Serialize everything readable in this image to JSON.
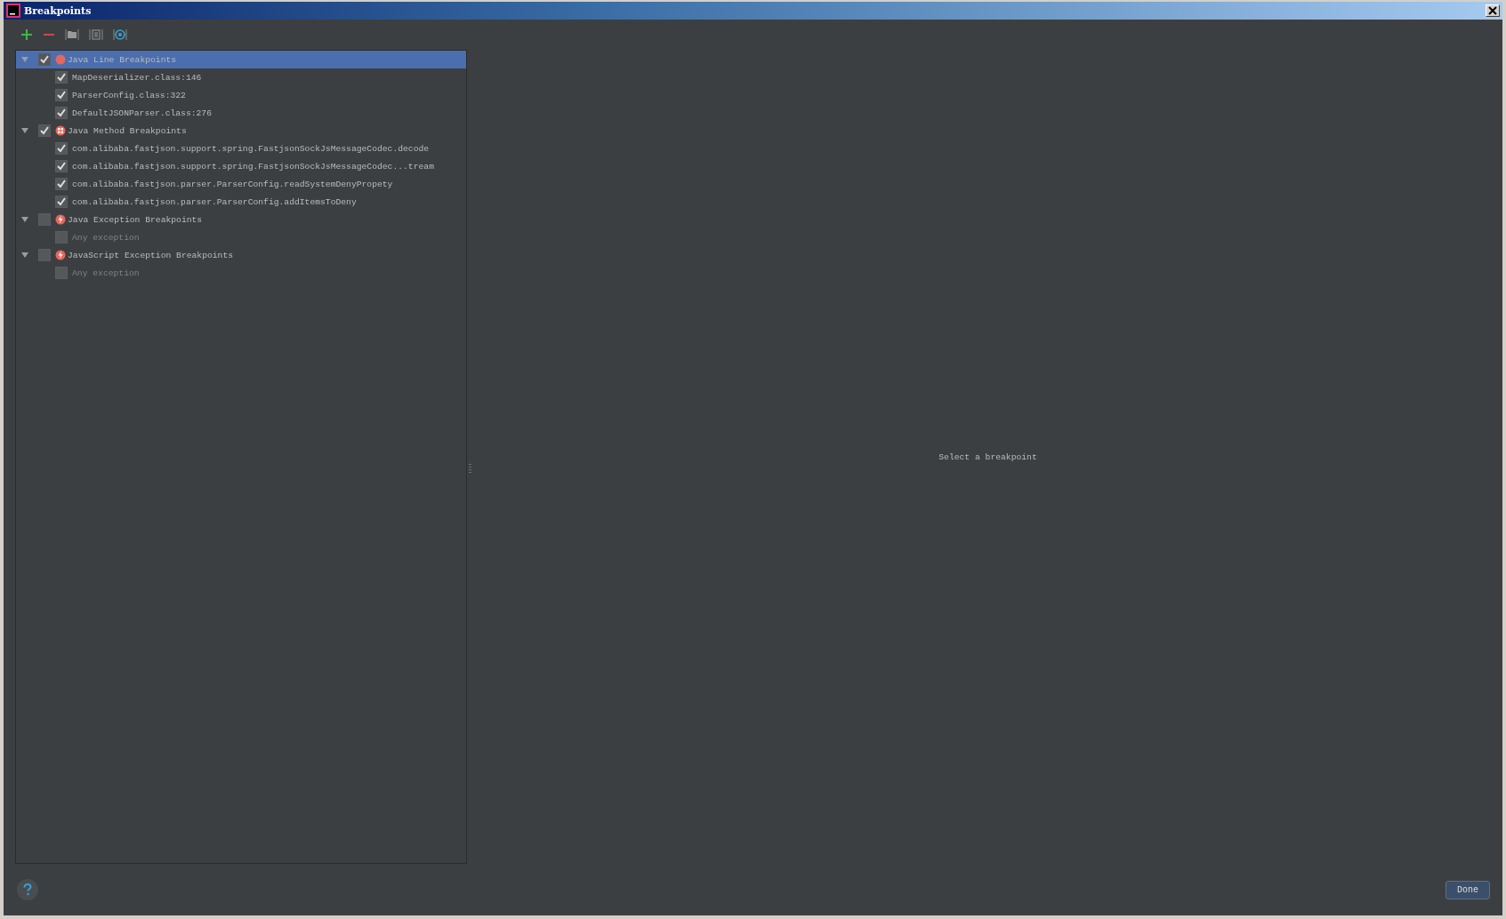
{
  "window": {
    "title": "Breakpoints"
  },
  "toolbar": [
    {
      "kind": "add"
    },
    {
      "kind": "remove"
    },
    {
      "kind": "folder"
    },
    {
      "kind": "document"
    },
    {
      "kind": "target"
    }
  ],
  "tree": [
    {
      "label": "Java Line Breakpoints",
      "kind": "line",
      "checked": true,
      "selected": true,
      "expanded": true,
      "children": [
        {
          "label": "MapDeserializer.class:146",
          "checked": true,
          "selected": false,
          "disabled": false
        },
        {
          "label": "ParserConfig.class:322",
          "checked": true,
          "selected": false,
          "disabled": false
        },
        {
          "label": "DefaultJSONParser.class:276",
          "checked": true,
          "selected": false,
          "disabled": false
        }
      ]
    },
    {
      "label": "Java Method Breakpoints",
      "kind": "method",
      "checked": true,
      "selected": false,
      "expanded": true,
      "children": [
        {
          "label": "com.alibaba.fastjson.support.spring.FastjsonSockJsMessageCodec.decode",
          "checked": true,
          "selected": false,
          "disabled": false
        },
        {
          "label": "com.alibaba.fastjson.support.spring.FastjsonSockJsMessageCodec...tream",
          "checked": true,
          "selected": false,
          "disabled": false
        },
        {
          "label": "com.alibaba.fastjson.parser.ParserConfig.readSystemDenyPropety",
          "checked": true,
          "selected": false,
          "disabled": false
        },
        {
          "label": "com.alibaba.fastjson.parser.ParserConfig.addItemsToDeny",
          "checked": true,
          "selected": false,
          "disabled": false
        }
      ]
    },
    {
      "label": "Java Exception Breakpoints",
      "kind": "exception",
      "checked": false,
      "selected": false,
      "expanded": true,
      "children": [
        {
          "label": "Any exception",
          "checked": false,
          "selected": false,
          "disabled": true
        }
      ]
    },
    {
      "label": "JavaScript Exception Breakpoints",
      "kind": "exception",
      "checked": false,
      "selected": false,
      "expanded": true,
      "children": [
        {
          "label": "Any exception",
          "checked": false,
          "selected": false,
          "disabled": true
        }
      ]
    }
  ],
  "detail": {
    "placeholder_text": "Select a breakpoint"
  },
  "buttons": [
    {
      "label": "Done"
    }
  ]
}
